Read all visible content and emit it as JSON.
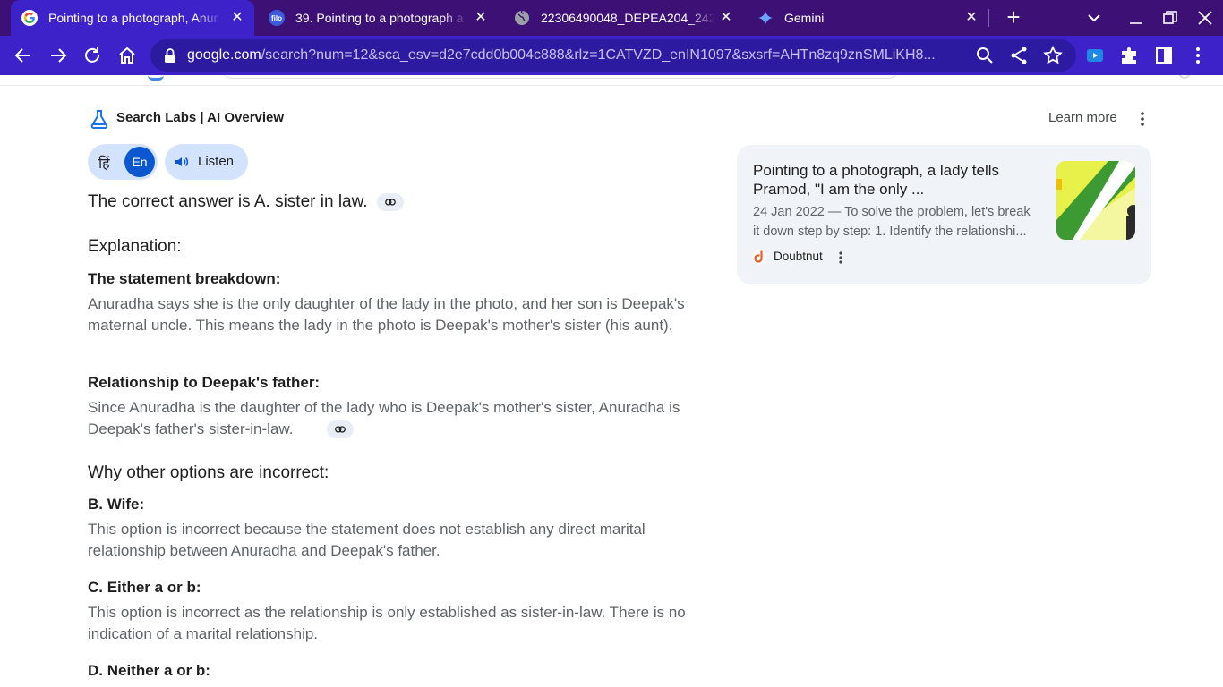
{
  "browser": {
    "tabs": [
      {
        "title": "Pointing to a photograph, Anur",
        "icon": "google-g-icon",
        "active": true
      },
      {
        "title": "39. Pointing to a photograph a",
        "icon": "filo-icon",
        "favicon_text": "filo",
        "active": false
      },
      {
        "title": "22306490048_DEPEA204_242",
        "icon": "globe-icon",
        "active": false
      },
      {
        "title": "Gemini",
        "icon": "gemini-sparkle-icon",
        "active": false
      }
    ],
    "url_host": "google.com",
    "url_path": "/search?num=12&sca_esv=d2e7cdd0b004c888&rlz=1CATVZD_enIN1097&sxsrf=AHTn8zq9znSMLiKH8...",
    "colors": {
      "tabstrip": "#3c1074",
      "toolbar": "#3c22c8",
      "omnibox": "#2c1aa0"
    }
  },
  "ai_overview": {
    "header": "Search Labs | AI Overview",
    "learn_more": "Learn more",
    "lang_hindi": "हिं",
    "lang_en": "En",
    "listen": "Listen",
    "answer": "The correct answer is A. sister in law.",
    "explanation_heading": "Explanation:",
    "sections": [
      {
        "heading": "The statement breakdown:",
        "body": "Anuradha says she is the only daughter of the lady in the photo, and her son is Deepak's maternal uncle. This means the lady in the photo is Deepak's mother's sister (his aunt)."
      },
      {
        "heading": "Relationship to Deepak's father:",
        "body": "Since Anuradha is the daughter of the lady who is Deepak's mother's sister, Anuradha is Deepak's father's sister-in-law."
      }
    ],
    "other_options_heading": "Why other options are incorrect:",
    "options": [
      {
        "heading": "B. Wife:",
        "body": "This option is incorrect because the statement does not establish any direct marital relationship between Anuradha and Deepak's father."
      },
      {
        "heading": "C. Either a or b:",
        "body": "This option is incorrect as the relationship is only established as sister-in-law. There is no indication of a marital relationship."
      },
      {
        "heading": "D. Neither a or b:",
        "body": ""
      }
    ]
  },
  "source_card": {
    "title": "Pointing to a photograph, a lady tells Pramod, \"I am the only ...",
    "snippet_line1": "24 Jan 2022 — To solve the problem, let's break",
    "snippet_line2": "it down step by step: 1. Identify the relationshi...",
    "source": "Doubtnut",
    "favicon": "doubtnut-icon",
    "thumbnail": "video-thumbnail-image"
  }
}
